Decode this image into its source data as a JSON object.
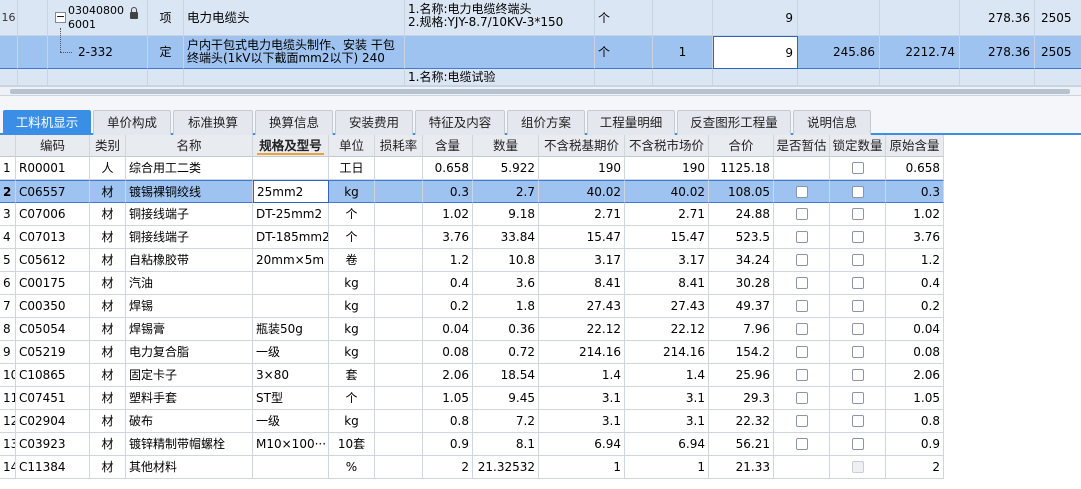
{
  "top": {
    "row16": {
      "row_num": "16",
      "code_line1": "03040800",
      "code_line2": "6001",
      "type": "项",
      "name": "电力电缆头",
      "feature_line1": "1.名称:电力电缆终端头",
      "feature_line2": "2.规格:YJY-8.7/10KV-3*150",
      "unit": "个",
      "qty": "9",
      "price": "278.36",
      "total": "2505"
    },
    "selected_row": {
      "code": "2-332",
      "type": "定",
      "name_line1": "户内干包式电力电缆头制作、安装 干包",
      "name_line2": "终端头(1kV以下截面mm2以下) 240",
      "unit": "个",
      "content": "1",
      "qty": "9",
      "price1": "245.86",
      "total1": "2212.74",
      "price2": "278.36",
      "total2": "2505"
    },
    "sub_row": {
      "feature": "1.名称:电缆试验"
    }
  },
  "tabs": [
    {
      "label": "工料机显示",
      "active": true
    },
    {
      "label": "单价构成",
      "active": false
    },
    {
      "label": "标准换算",
      "active": false
    },
    {
      "label": "换算信息",
      "active": false
    },
    {
      "label": "安装费用",
      "active": false
    },
    {
      "label": "特征及内容",
      "active": false
    },
    {
      "label": "组价方案",
      "active": false
    },
    {
      "label": "工程量明细",
      "active": false
    },
    {
      "label": "反查图形工程量",
      "active": false
    },
    {
      "label": "说明信息",
      "active": false
    }
  ],
  "table": {
    "headers": [
      "",
      "编码",
      "类别",
      "名称",
      "规格及型号",
      "单位",
      "损耗率",
      "含量",
      "数量",
      "不含税基期价",
      "不含税市场价",
      "合价",
      "是否暂估",
      "锁定数量",
      "原始含量"
    ],
    "rows": [
      {
        "n": "1",
        "code": "R00001",
        "cat": "人",
        "name": "综合用工二类",
        "spec": "",
        "unit": "工日",
        "loss": "",
        "content": "0.658",
        "qty": "5.922",
        "base": "190",
        "market": "190",
        "total": "1125.18",
        "est": false,
        "lock": true,
        "orig": "0.658"
      },
      {
        "n": "2",
        "code": "C06557",
        "cat": "材",
        "name": "镀锡裸铜绞线",
        "spec": "25mm2",
        "unit": "kg",
        "loss": "",
        "content": "0.3",
        "qty": "2.7",
        "base": "40.02",
        "market": "40.02",
        "total": "108.05",
        "est": true,
        "lock": true,
        "orig": "0.3"
      },
      {
        "n": "3",
        "code": "C07006",
        "cat": "材",
        "name": "铜接线端子",
        "spec": "DT-25mm2",
        "unit": "个",
        "loss": "",
        "content": "1.02",
        "qty": "9.18",
        "base": "2.71",
        "market": "2.71",
        "total": "24.88",
        "est": true,
        "lock": true,
        "orig": "1.02"
      },
      {
        "n": "4",
        "code": "C07013",
        "cat": "材",
        "name": "铜接线端子",
        "spec": "DT-185mm2",
        "unit": "个",
        "loss": "",
        "content": "3.76",
        "qty": "33.84",
        "base": "15.47",
        "market": "15.47",
        "total": "523.5",
        "est": true,
        "lock": true,
        "orig": "3.76"
      },
      {
        "n": "5",
        "code": "C05612",
        "cat": "材",
        "name": "自粘橡胶带",
        "spec": "20mm×5m",
        "unit": "卷",
        "loss": "",
        "content": "1.2",
        "qty": "10.8",
        "base": "3.17",
        "market": "3.17",
        "total": "34.24",
        "est": true,
        "lock": true,
        "orig": "1.2"
      },
      {
        "n": "6",
        "code": "C00175",
        "cat": "材",
        "name": "汽油",
        "spec": "",
        "unit": "kg",
        "loss": "",
        "content": "0.4",
        "qty": "3.6",
        "base": "8.41",
        "market": "8.41",
        "total": "30.28",
        "est": true,
        "lock": true,
        "orig": "0.4"
      },
      {
        "n": "7",
        "code": "C00350",
        "cat": "材",
        "name": "焊锡",
        "spec": "",
        "unit": "kg",
        "loss": "",
        "content": "0.2",
        "qty": "1.8",
        "base": "27.43",
        "market": "27.43",
        "total": "49.37",
        "est": true,
        "lock": true,
        "orig": "0.2"
      },
      {
        "n": "8",
        "code": "C05054",
        "cat": "材",
        "name": "焊锡膏",
        "spec": "瓶装50g",
        "unit": "kg",
        "loss": "",
        "content": "0.04",
        "qty": "0.36",
        "base": "22.12",
        "market": "22.12",
        "total": "7.96",
        "est": true,
        "lock": true,
        "orig": "0.04"
      },
      {
        "n": "9",
        "code": "C05219",
        "cat": "材",
        "name": "电力复合脂",
        "spec": "一级",
        "unit": "kg",
        "loss": "",
        "content": "0.08",
        "qty": "0.72",
        "base": "214.16",
        "market": "214.16",
        "total": "154.2",
        "est": true,
        "lock": true,
        "orig": "0.08"
      },
      {
        "n": "10",
        "code": "C10865",
        "cat": "材",
        "name": "固定卡子",
        "spec": "3×80",
        "unit": "套",
        "loss": "",
        "content": "2.06",
        "qty": "18.54",
        "base": "1.4",
        "market": "1.4",
        "total": "25.96",
        "est": true,
        "lock": true,
        "orig": "2.06"
      },
      {
        "n": "11",
        "code": "C07451",
        "cat": "材",
        "name": "塑料手套",
        "spec": "ST型",
        "unit": "个",
        "loss": "",
        "content": "1.05",
        "qty": "9.45",
        "base": "3.1",
        "market": "3.1",
        "total": "29.3",
        "est": true,
        "lock": true,
        "orig": "1.05"
      },
      {
        "n": "12",
        "code": "C02904",
        "cat": "材",
        "name": "破布",
        "spec": "一级",
        "unit": "kg",
        "loss": "",
        "content": "0.8",
        "qty": "7.2",
        "base": "3.1",
        "market": "3.1",
        "total": "22.32",
        "est": true,
        "lock": true,
        "orig": "0.8"
      },
      {
        "n": "13",
        "code": "C03923",
        "cat": "材",
        "name": "镀锌精制带帽螺栓",
        "spec": "M10×100···",
        "unit": "10套",
        "loss": "",
        "content": "0.9",
        "qty": "8.1",
        "base": "6.94",
        "market": "6.94",
        "total": "56.21",
        "est": true,
        "lock": true,
        "orig": "0.9"
      },
      {
        "n": "14",
        "code": "C11384",
        "cat": "材",
        "name": "其他材料",
        "spec": "",
        "unit": "%",
        "loss": "",
        "content": "2",
        "qty": "21.32532",
        "base": "1",
        "market": "1",
        "total": "21.33",
        "est": false,
        "lock": "disabled",
        "orig": "2"
      }
    ]
  },
  "colors": {
    "accent": "#3a8ee6",
    "selected_row": "#9fc3f0",
    "parent_row": "#dbe6f4",
    "header_underline": "#e8a33a"
  }
}
